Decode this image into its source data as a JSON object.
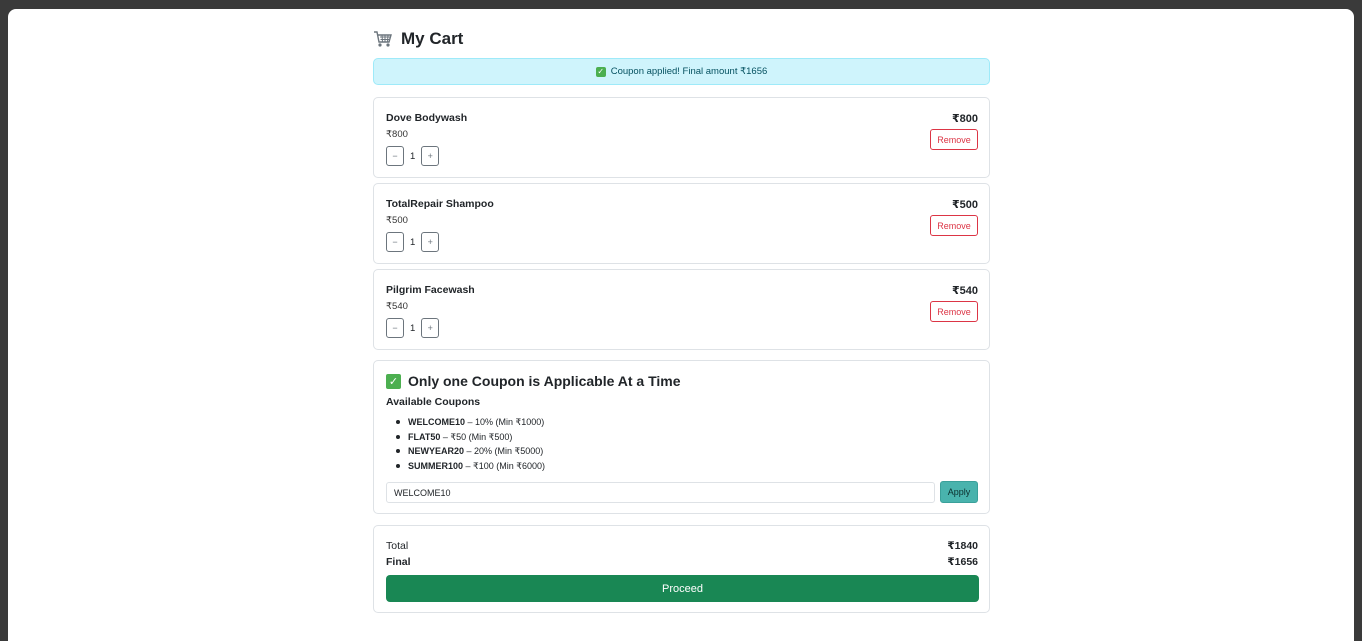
{
  "page": {
    "title": "My Cart",
    "icon": "shopping-cart-icon"
  },
  "alert": {
    "text": "Coupon applied! Final amount ₹1656",
    "icon": "check-box-icon",
    "color": "#cff4fc"
  },
  "cart": {
    "items": [
      {
        "name": "Dove Bodywash",
        "unit_price": "₹800",
        "quantity": "1",
        "total": "₹800",
        "remove_label": "Remove"
      },
      {
        "name": "TotalRepair Shampoo",
        "unit_price": "₹500",
        "quantity": "1",
        "total": "₹500",
        "remove_label": "Remove"
      },
      {
        "name": "Pilgrim Facewash",
        "unit_price": "₹540",
        "quantity": "1",
        "total": "₹540",
        "remove_label": "Remove"
      }
    ],
    "decrement_label": "−",
    "increment_label": "+"
  },
  "coupons": {
    "heading": "Only one Coupon is Applicable At a Time",
    "subheading": "Available Coupons",
    "list": [
      {
        "code": "WELCOME10",
        "desc": " – 10% (Min ₹1000)"
      },
      {
        "code": "FLAT50",
        "desc": " – ₹50 (Min ₹500)"
      },
      {
        "code": "NEWYEAR20",
        "desc": " – 20% (Min ₹5000)"
      },
      {
        "code": "SUMMER100",
        "desc": " – ₹100 (Min ₹6000)"
      }
    ],
    "input_value": "WELCOME10",
    "apply_label": "Apply"
  },
  "summary": {
    "total_label": "Total",
    "total_value": "₹1840",
    "final_label": "Final",
    "final_value": "₹1656",
    "proceed_label": "Proceed"
  },
  "colors": {
    "accent_green": "#198754",
    "danger": "#dc3545",
    "info_bg": "#cff4fc",
    "apply_teal": "#49b3ad"
  }
}
